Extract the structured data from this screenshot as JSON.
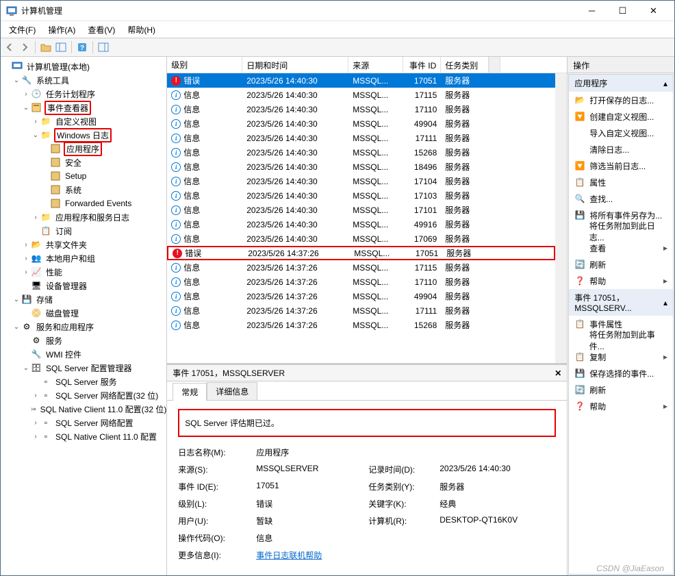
{
  "window": {
    "title": "计算机管理"
  },
  "menus": {
    "file": "文件(F)",
    "action": "操作(A)",
    "view": "查看(V)",
    "help": "帮助(H)"
  },
  "tree": {
    "root": "计算机管理(本地)",
    "systools": "系统工具",
    "taskscheduler": "任务计划程序",
    "eventviewer": "事件查看器",
    "customviews": "自定义视图",
    "winlogs": "Windows 日志",
    "app": "应用程序",
    "security": "安全",
    "setup": "Setup",
    "system": "系统",
    "forwarded": "Forwarded Events",
    "appsvclogs": "应用程序和服务日志",
    "subs": "订阅",
    "shared": "共享文件夹",
    "localusers": "本地用户和组",
    "perf": "性能",
    "devmgr": "设备管理器",
    "storage": "存储",
    "diskmgr": "磁盘管理",
    "services_apps": "服务和应用程序",
    "services": "服务",
    "wmi": "WMI 控件",
    "sqlconfig": "SQL Server 配置管理器",
    "sqlservices": "SQL Server 服务",
    "sqlnet32": "SQL Server 网络配置(32 位)",
    "sqlnative32": "SQL Native Client 11.0 配置(32 位)",
    "sqlnet": "SQL Server 网络配置",
    "sqlnative": "SQL Native Client 11.0 配置"
  },
  "columns": {
    "level": "级别",
    "datetime": "日期和时间",
    "source": "来源",
    "eventid": "事件 ID",
    "category": "任务类别"
  },
  "events": [
    {
      "lvl": "err",
      "lvltxt": "错误",
      "dt": "2023/5/26 14:40:30",
      "src": "MSSQL...",
      "id": "17051",
      "cat": "服务器",
      "sel": true
    },
    {
      "lvl": "info",
      "lvltxt": "信息",
      "dt": "2023/5/26 14:40:30",
      "src": "MSSQL...",
      "id": "17115",
      "cat": "服务器"
    },
    {
      "lvl": "info",
      "lvltxt": "信息",
      "dt": "2023/5/26 14:40:30",
      "src": "MSSQL...",
      "id": "17110",
      "cat": "服务器"
    },
    {
      "lvl": "info",
      "lvltxt": "信息",
      "dt": "2023/5/26 14:40:30",
      "src": "MSSQL...",
      "id": "49904",
      "cat": "服务器"
    },
    {
      "lvl": "info",
      "lvltxt": "信息",
      "dt": "2023/5/26 14:40:30",
      "src": "MSSQL...",
      "id": "17111",
      "cat": "服务器"
    },
    {
      "lvl": "info",
      "lvltxt": "信息",
      "dt": "2023/5/26 14:40:30",
      "src": "MSSQL...",
      "id": "15268",
      "cat": "服务器"
    },
    {
      "lvl": "info",
      "lvltxt": "信息",
      "dt": "2023/5/26 14:40:30",
      "src": "MSSQL...",
      "id": "18496",
      "cat": "服务器"
    },
    {
      "lvl": "info",
      "lvltxt": "信息",
      "dt": "2023/5/26 14:40:30",
      "src": "MSSQL...",
      "id": "17104",
      "cat": "服务器"
    },
    {
      "lvl": "info",
      "lvltxt": "信息",
      "dt": "2023/5/26 14:40:30",
      "src": "MSSQL...",
      "id": "17103",
      "cat": "服务器"
    },
    {
      "lvl": "info",
      "lvltxt": "信息",
      "dt": "2023/5/26 14:40:30",
      "src": "MSSQL...",
      "id": "17101",
      "cat": "服务器"
    },
    {
      "lvl": "info",
      "lvltxt": "信息",
      "dt": "2023/5/26 14:40:30",
      "src": "MSSQL...",
      "id": "49916",
      "cat": "服务器"
    },
    {
      "lvl": "info",
      "lvltxt": "信息",
      "dt": "2023/5/26 14:40:30",
      "src": "MSSQL...",
      "id": "17069",
      "cat": "服务器"
    },
    {
      "lvl": "err",
      "lvltxt": "错误",
      "dt": "2023/5/26 14:37:26",
      "src": "MSSQL...",
      "id": "17051",
      "cat": "服务器",
      "hl": true
    },
    {
      "lvl": "info",
      "lvltxt": "信息",
      "dt": "2023/5/26 14:37:26",
      "src": "MSSQL...",
      "id": "17115",
      "cat": "服务器"
    },
    {
      "lvl": "info",
      "lvltxt": "信息",
      "dt": "2023/5/26 14:37:26",
      "src": "MSSQL...",
      "id": "17110",
      "cat": "服务器"
    },
    {
      "lvl": "info",
      "lvltxt": "信息",
      "dt": "2023/5/26 14:37:26",
      "src": "MSSQL...",
      "id": "49904",
      "cat": "服务器"
    },
    {
      "lvl": "info",
      "lvltxt": "信息",
      "dt": "2023/5/26 14:37:26",
      "src": "MSSQL...",
      "id": "17111",
      "cat": "服务器"
    },
    {
      "lvl": "info",
      "lvltxt": "信息",
      "dt": "2023/5/26 14:37:26",
      "src": "MSSQL...",
      "id": "15268",
      "cat": "服务器"
    }
  ],
  "detail": {
    "title": "事件 17051，MSSQLSERVER",
    "tabs": {
      "general": "常规",
      "details": "详细信息"
    },
    "message": "SQL Server 评估期已过。",
    "labels": {
      "logname": "日志名称(M):",
      "source": "来源(S):",
      "eventid": "事件 ID(E):",
      "level": "级别(L):",
      "user": "用户(U):",
      "opcode": "操作代码(O):",
      "moreinfo": "更多信息(I):",
      "logged": "记录时间(D):",
      "category": "任务类别(Y):",
      "keywords": "关键字(K):",
      "computer": "计算机(R):"
    },
    "values": {
      "logname": "应用程序",
      "source": "MSSQLSERVER",
      "eventid": "17051",
      "level": "错误",
      "user": "暂缺",
      "opcode": "信息",
      "moreinfo": "事件日志联机帮助",
      "logged": "2023/5/26 14:40:30",
      "category": "服务器",
      "keywords": "经典",
      "computer": "DESKTOP-QT16K0V"
    }
  },
  "actions": {
    "header": "操作",
    "section1": "应用程序",
    "section2": "事件 17051，MSSQLSERV...",
    "items1": [
      "打开保存的日志...",
      "创建自定义视图...",
      "导入自定义视图...",
      "清除日志...",
      "筛选当前日志...",
      "属性",
      "查找...",
      "将所有事件另存为...",
      "将任务附加到此日志...",
      "查看",
      "刷新",
      "帮助"
    ],
    "items2": [
      "事件属性",
      "将任务附加到此事件...",
      "复制",
      "保存选择的事件...",
      "刷新",
      "帮助"
    ]
  },
  "watermark": "CSDN @JiaEason"
}
